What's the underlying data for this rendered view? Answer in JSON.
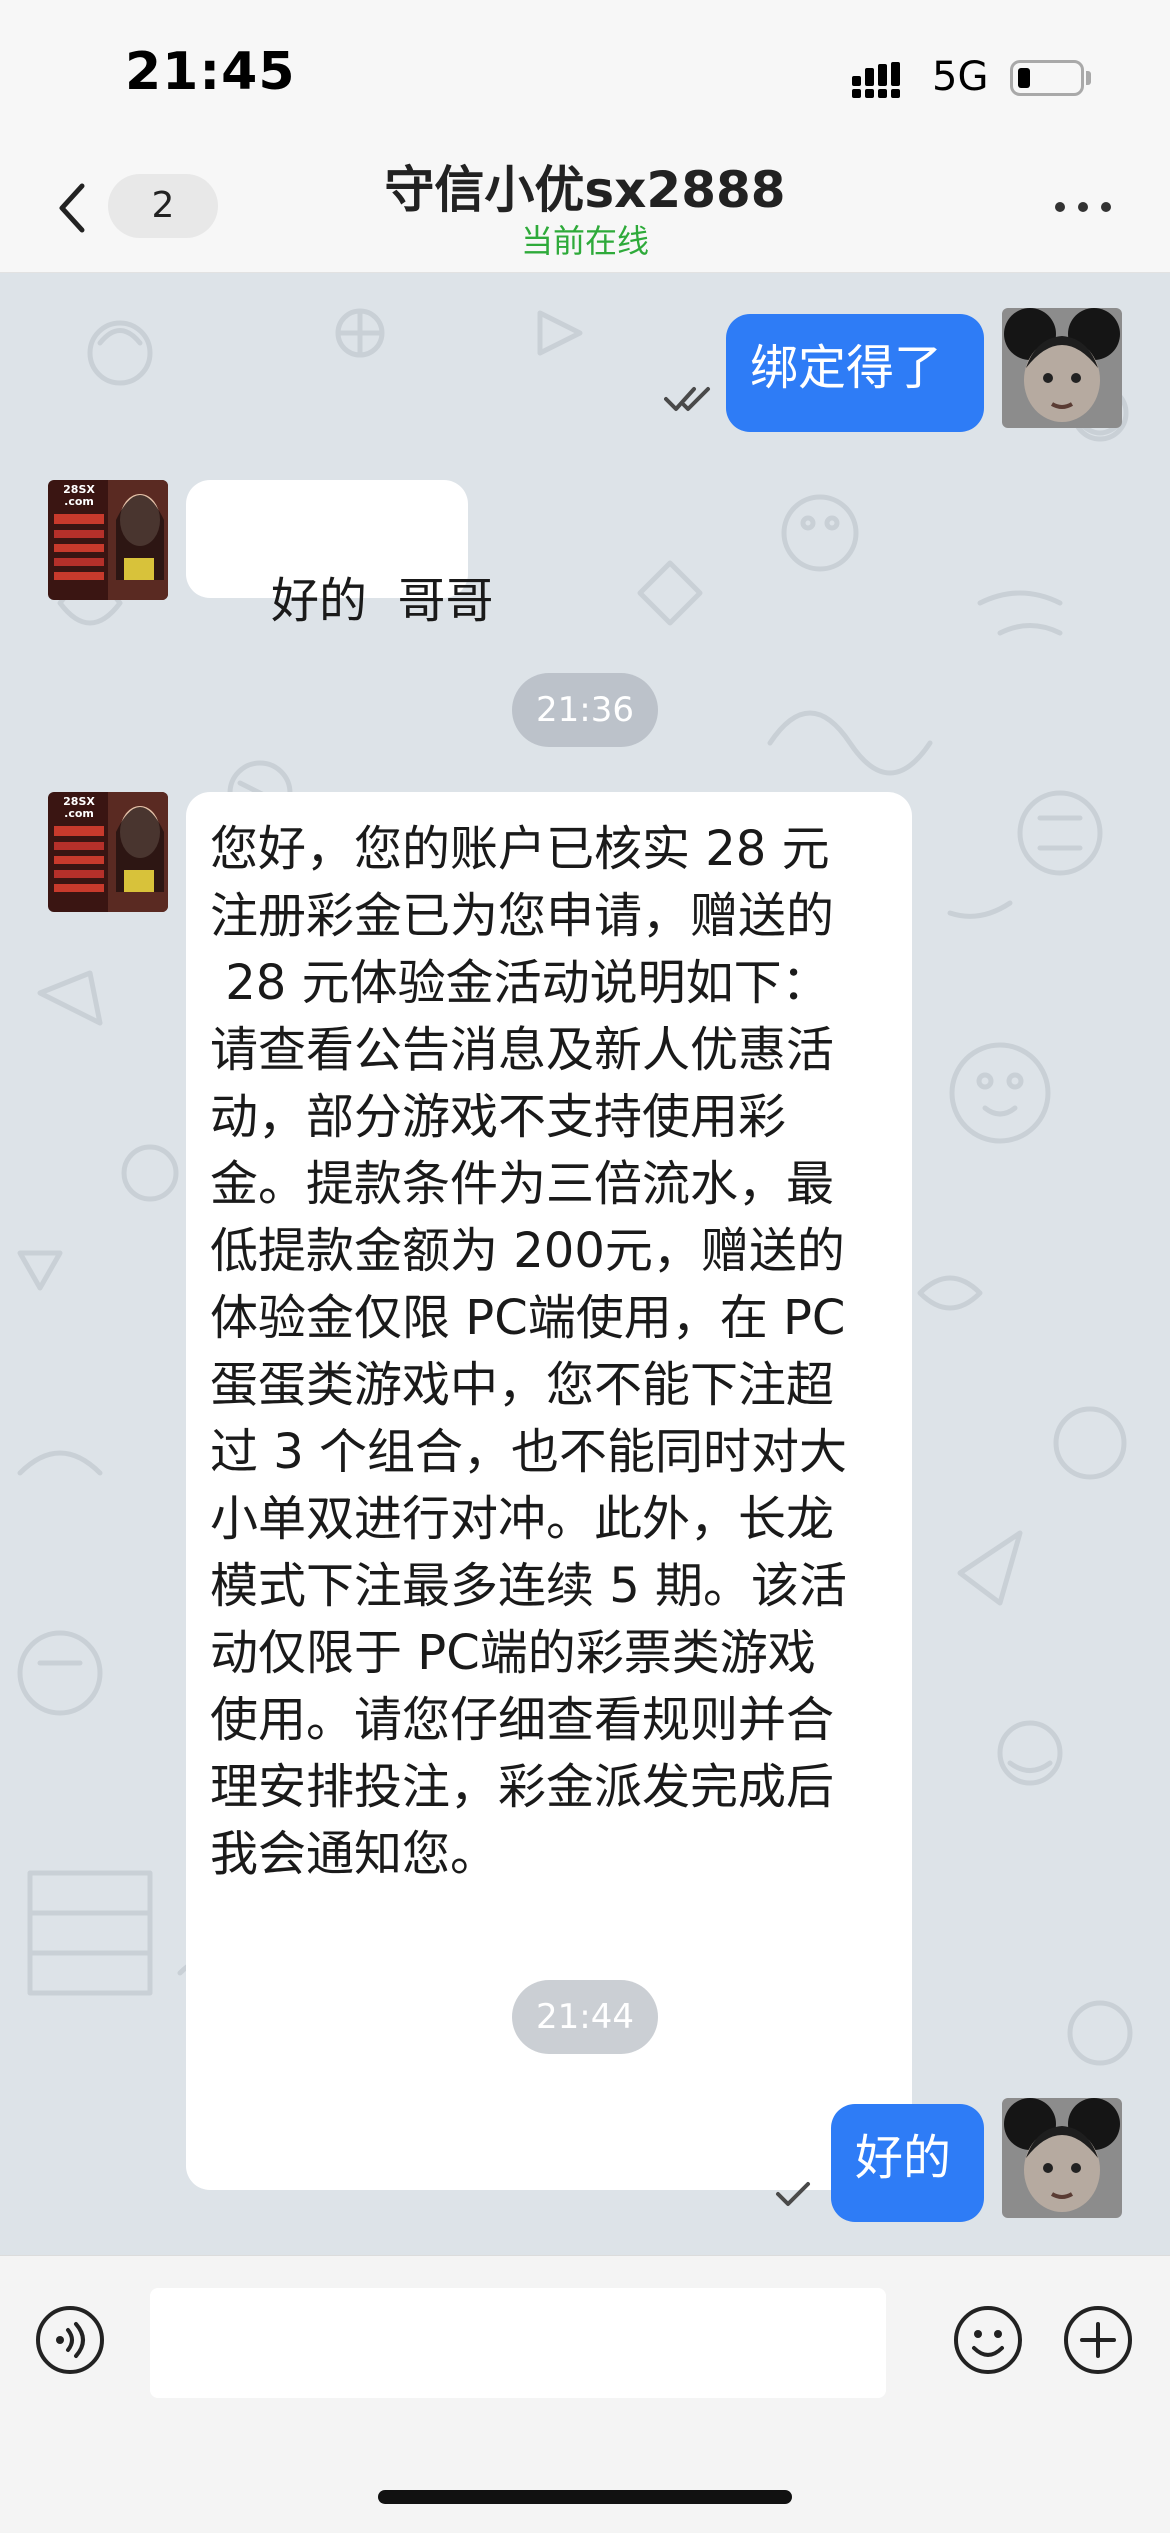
{
  "status_bar": {
    "time": "21:45",
    "network": "5G",
    "icons": [
      "signal-icon",
      "battery-icon"
    ]
  },
  "header": {
    "back_icon": "chevron-left-icon",
    "unread_count": "2",
    "contact_name": "守信小优sx2888",
    "contact_status": "当前在线",
    "more_icon": "more-dots-icon"
  },
  "messages": [
    {
      "type": "outgoing",
      "text": "绑定得了",
      "read_icon": "double-check-icon"
    },
    {
      "type": "incoming",
      "text": "好的  哥哥"
    },
    {
      "type": "timestamp",
      "text": "21:36"
    },
    {
      "type": "incoming",
      "lines": [
        "您好，您的账户已核实 28 元",
        "注册彩金已为您申请，赠送的",
        " 28 元体验金活动说明如下：",
        "请查看公告消息及新人优惠活",
        "动，部分游戏不支持使用彩",
        "金。提款条件为三倍流水，最",
        "低提款金额为 200元，赠送的",
        "体验金仅限 PC端使用，在 PC",
        "蛋蛋类游戏中，您不能下注超",
        "过 3 个组合，也不能同时对大",
        "小单双进行对冲。此外，长龙",
        "模式下注最多连续 5 期。该活",
        "动仅限于 PC端的彩票类游戏",
        "使用。请您仔细查看规则并合",
        "理安排投注，彩金派发完成后",
        "我会通知您。"
      ]
    },
    {
      "type": "timestamp",
      "text": "21:44"
    },
    {
      "type": "outgoing",
      "text": "好的",
      "read_icon": "single-check-icon"
    }
  ],
  "incoming_avatar_logo": "28SX .com",
  "input_bar": {
    "placeholder": "",
    "icons": [
      "voice-icon",
      "emoji-icon",
      "plus-icon"
    ]
  },
  "colors": {
    "outgoing_bubble": "#2e7cf6",
    "incoming_bubble": "#ffffff",
    "online_status": "#2eaa3a",
    "chat_background": "#dde3e8"
  }
}
